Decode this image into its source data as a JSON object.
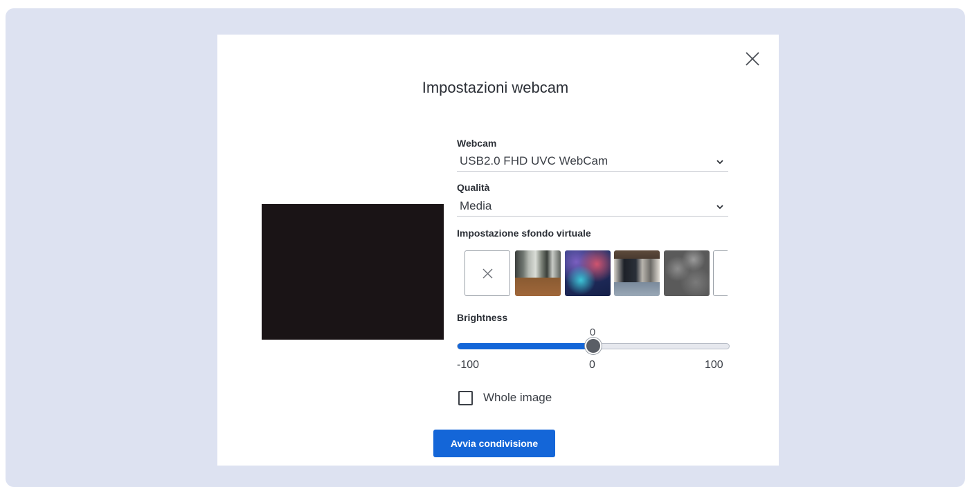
{
  "dialog": {
    "title": "Impostazioni webcam",
    "close_icon": "close-icon"
  },
  "webcam": {
    "label": "Webcam",
    "selected": "USB2.0 FHD UVC WebCam",
    "icon": "chevron-down-icon"
  },
  "quality": {
    "label": "Qualità",
    "selected": "Media",
    "icon": "chevron-down-icon"
  },
  "virtual_background": {
    "label": "Impostazione sfondo virtuale",
    "options": [
      {
        "name": "none",
        "icon": "close-icon"
      },
      {
        "name": "office-1"
      },
      {
        "name": "nebula"
      },
      {
        "name": "office-2"
      },
      {
        "name": "stone"
      },
      {
        "name": "more"
      }
    ]
  },
  "brightness": {
    "label": "Brightness",
    "value": 0,
    "min": -100,
    "max": 100,
    "value_text": "0",
    "min_text": "-100",
    "mid_text": "0",
    "max_text": "100"
  },
  "whole_image": {
    "label": "Whole image",
    "checked": false
  },
  "actions": {
    "start_label": "Avvia condivisione"
  },
  "colors": {
    "accent": "#1466d8",
    "backdrop": "#dde2f1"
  }
}
